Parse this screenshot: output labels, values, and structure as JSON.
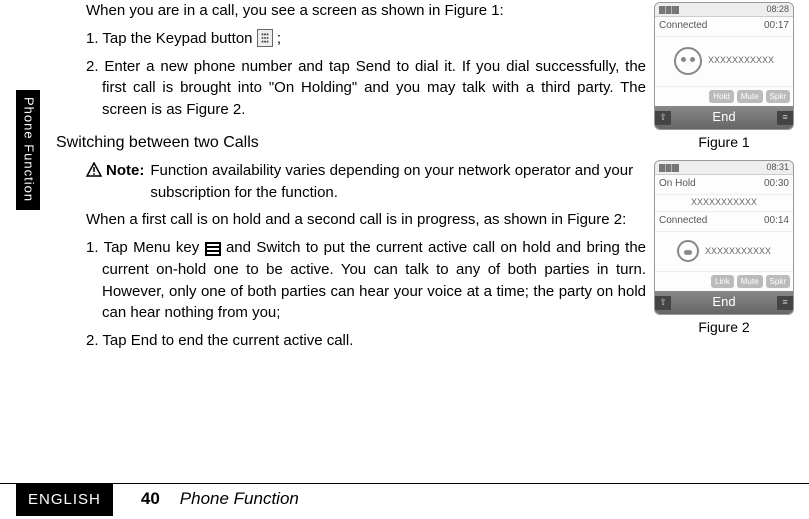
{
  "sideTab": "Phone Function",
  "intro1": "When you are in a call, you see a screen as shown in Figure 1:",
  "step1a": "1. Tap the Keypad button",
  "step1b": " ;",
  "step2": "2. Enter a new phone number and tap Send to dial it. If you dial successfully, the first call is brought into \"On Holding\" and you may talk with a third party. The screen is as Figure 2.",
  "heading": "Switching between two Calls",
  "noteLabel": "Note:",
  "noteText": "Function availability varies depending on your network operator and your subscription for the function.",
  "intro2": "When a first call is on hold and a second call is in progress, as shown in Figure 2:",
  "step3a": "1. Tap Menu key",
  "step3b": "and Switch to put the current active call on hold and bring the current on-hold one to be active. You can talk to any of both parties in turn. However, only one of both parties can hear your voice at a time; the party on hold can hear nothing from you;",
  "step4": "2. Tap End to end the current active call.",
  "fig1": {
    "clock": "08:28",
    "status": "Connected",
    "timer": "00:17",
    "xnum": "XXXXXXXXXXX",
    "btns": [
      "Hold",
      "Mute",
      "Spkr"
    ],
    "end": "End",
    "caption": "Figure 1",
    "leftIcon": "⇧",
    "rightIcon": "≡"
  },
  "fig2": {
    "clock": "08:31",
    "onhold": "On Hold",
    "onholdTimer": "00:30",
    "xnum1": "XXXXXXXXXXX",
    "status": "Connected",
    "timer": "00:14",
    "xnum2": "XXXXXXXXXXX",
    "btns": [
      "Link",
      "Mute",
      "Spkr"
    ],
    "end": "End",
    "caption": "Figure 2",
    "leftIcon": "⇧",
    "rightIcon": "≡"
  },
  "footer": {
    "lang": "ENGLISH",
    "page": "40",
    "title": "Phone Function"
  }
}
